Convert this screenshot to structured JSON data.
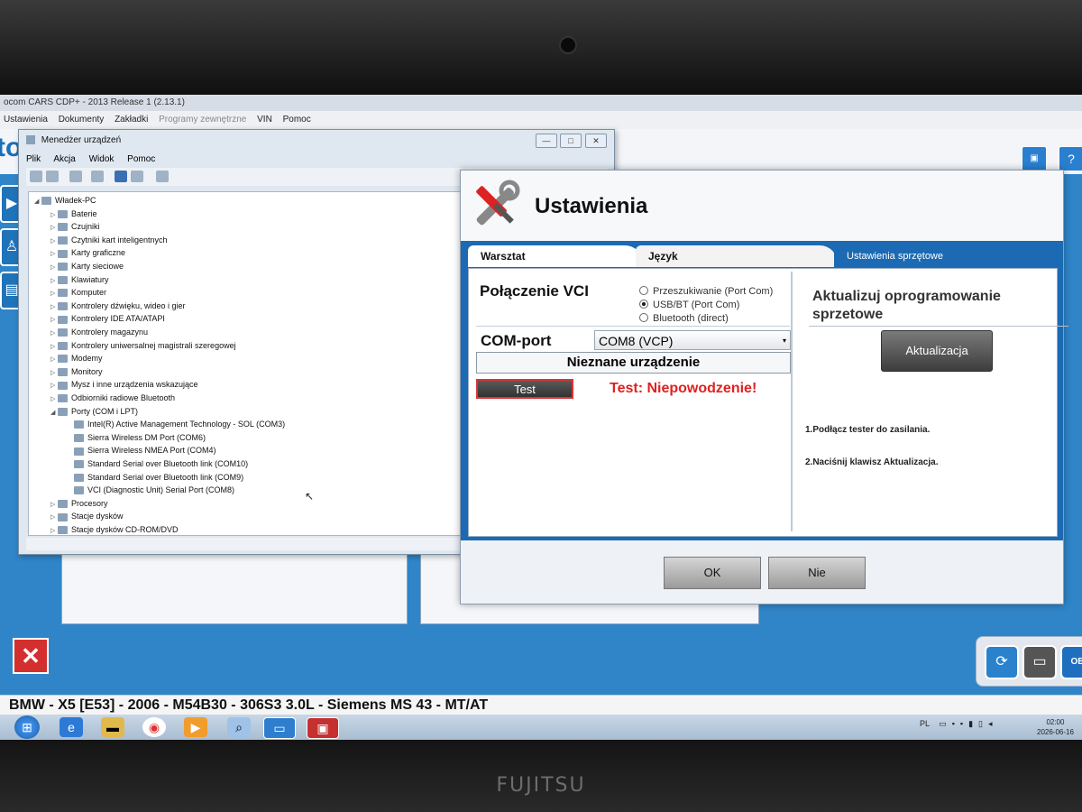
{
  "app": {
    "title": "ocom CARS CDP+ - 2013 Release 1 (2.13.1)",
    "logo": "to",
    "menu": [
      "Ustawienia",
      "Dokumenty",
      "Zakładki",
      "Programy zewnętrzne",
      "VIN",
      "Pomoc"
    ]
  },
  "devmgr": {
    "title": "Menedżer urządzeń",
    "menu": [
      "Plik",
      "Akcja",
      "Widok",
      "Pomoc"
    ],
    "tree": [
      {
        "label": "Władek-PC",
        "level": 0,
        "arrow": "◢"
      },
      {
        "label": "Baterie",
        "level": 1,
        "arrow": "▷"
      },
      {
        "label": "Czujniki",
        "level": 1,
        "arrow": "▷"
      },
      {
        "label": "Czytniki kart inteligentnych",
        "level": 1,
        "arrow": "▷"
      },
      {
        "label": "Karty graficzne",
        "level": 1,
        "arrow": "▷"
      },
      {
        "label": "Karty sieciowe",
        "level": 1,
        "arrow": "▷"
      },
      {
        "label": "Klawiatury",
        "level": 1,
        "arrow": "▷"
      },
      {
        "label": "Komputer",
        "level": 1,
        "arrow": "▷"
      },
      {
        "label": "Kontrolery dźwięku, wideo i gier",
        "level": 1,
        "arrow": "▷"
      },
      {
        "label": "Kontrolery IDE ATA/ATAPI",
        "level": 1,
        "arrow": "▷"
      },
      {
        "label": "Kontrolery magazynu",
        "level": 1,
        "arrow": "▷"
      },
      {
        "label": "Kontrolery uniwersalnej magistrali szeregowej",
        "level": 1,
        "arrow": "▷"
      },
      {
        "label": "Modemy",
        "level": 1,
        "arrow": "▷"
      },
      {
        "label": "Monitory",
        "level": 1,
        "arrow": "▷"
      },
      {
        "label": "Mysz i inne urządzenia wskazujące",
        "level": 1,
        "arrow": "▷"
      },
      {
        "label": "Odbiorniki radiowe Bluetooth",
        "level": 1,
        "arrow": "▷"
      },
      {
        "label": "Porty (COM i LPT)",
        "level": 1,
        "arrow": "◢"
      },
      {
        "label": "Intel(R) Active Management Technology - SOL (COM3)",
        "level": 2,
        "arrow": ""
      },
      {
        "label": "Sierra Wireless DM Port (COM6)",
        "level": 2,
        "arrow": ""
      },
      {
        "label": "Sierra Wireless NMEA Port (COM4)",
        "level": 2,
        "arrow": ""
      },
      {
        "label": "Standard Serial over Bluetooth link (COM10)",
        "level": 2,
        "arrow": ""
      },
      {
        "label": "Standard Serial over Bluetooth link (COM9)",
        "level": 2,
        "arrow": ""
      },
      {
        "label": "VCI (Diagnostic Unit) Serial Port (COM8)",
        "level": 2,
        "arrow": ""
      },
      {
        "label": "Procesory",
        "level": 1,
        "arrow": "▷"
      },
      {
        "label": "Stacje dysków",
        "level": 1,
        "arrow": "▷"
      },
      {
        "label": "Stacje dysków CD-ROM/DVD",
        "level": 1,
        "arrow": "▷"
      }
    ]
  },
  "settings": {
    "title": "Ustawienia",
    "tabs": [
      "Warsztat",
      "Język",
      "Ustawienia sprzętowe"
    ],
    "vci_label": "Połączenie VCI",
    "radios": [
      "Przeszukiwanie (Port Com)",
      "USB/BT (Port Com)",
      "Bluetooth (direct)"
    ],
    "selected_radio": 1,
    "com_label": "COM-port",
    "com_value": "COM8 (VCP)",
    "device_status": "Nieznane urządzenie",
    "test_button": "Test",
    "test_result": "Test: Niepowodzenie!",
    "update_heading": "Aktualizuj oprogramowanie sprzetowe",
    "update_button": "Aktualizacja",
    "step1": "1.Podłącz tester do zasilania.",
    "step2": "2.Naciśnij klawisz Aktualizacja.",
    "ok_button": "OK",
    "no_button": "Nie"
  },
  "statusbar": {
    "vehicle": "BMW - X5 [E53] - 2006 - M54B30 - 306S3 3.0L - Siemens MS 43 - MT/AT"
  },
  "taskbar": {
    "language": "PL",
    "time": "02:00",
    "date": "2026-06-16"
  },
  "laptop": {
    "brand": "FUJITSU"
  },
  "colors": {
    "accent": "#1c6ab3",
    "error": "#e02020",
    "close": "#d32f2f"
  }
}
